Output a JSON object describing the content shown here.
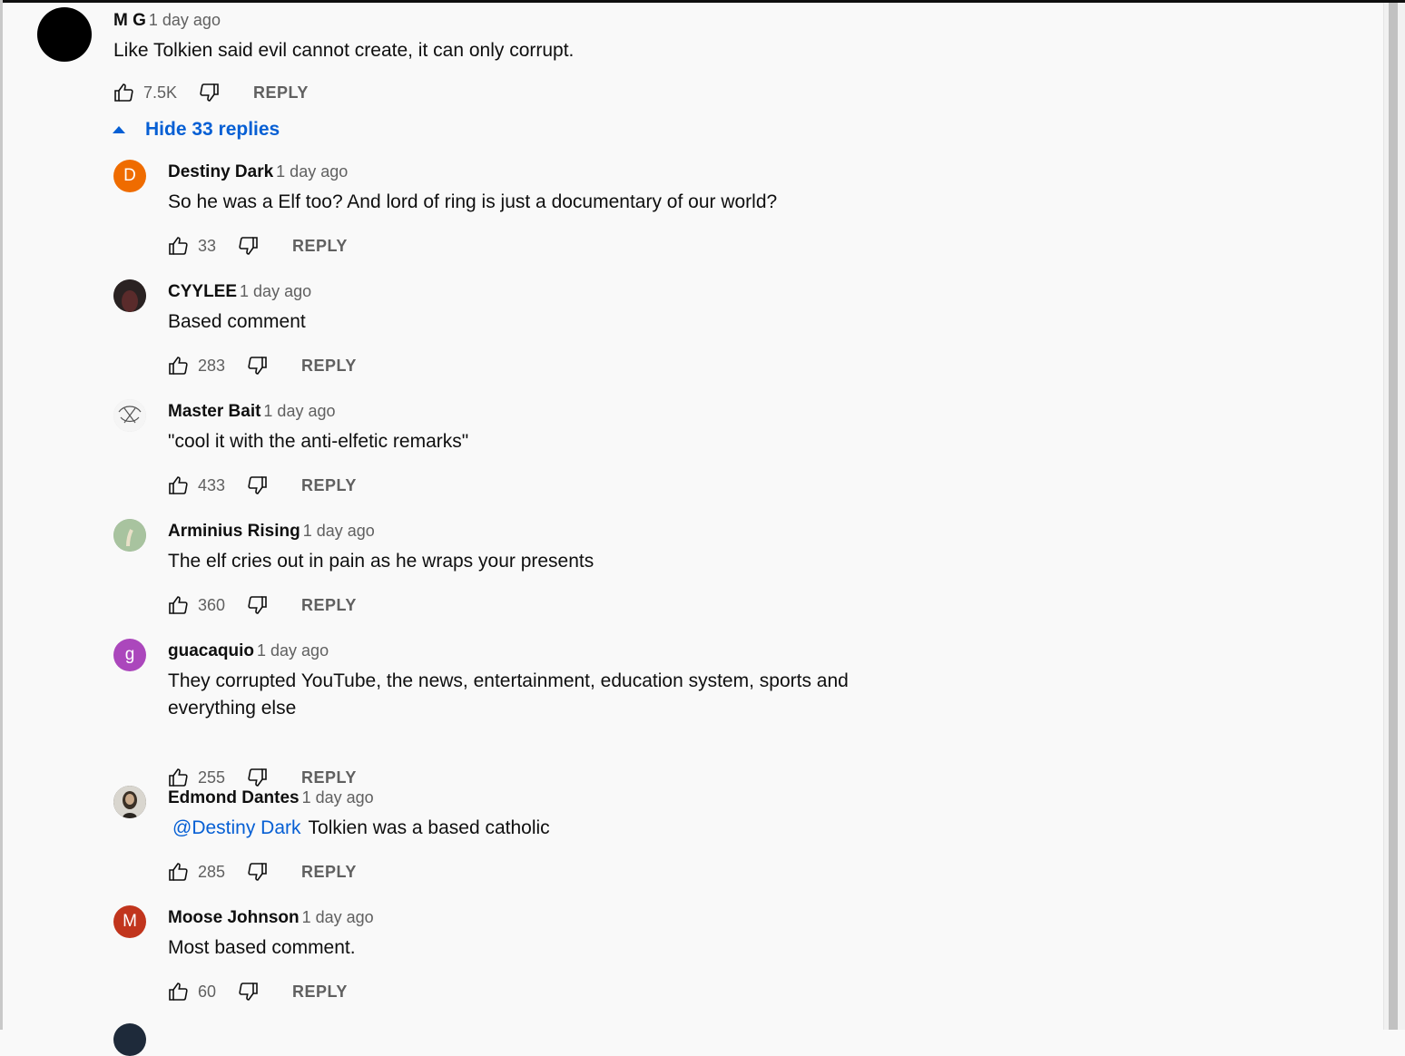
{
  "top_comment": {
    "author": "M G",
    "time": "1 day ago",
    "text": "Like Tolkien said evil cannot create, it can only corrupt.",
    "likes": "7.5K",
    "reply_label": "REPLY"
  },
  "replies_toggle": {
    "label": "Hide 33 replies"
  },
  "replies": [
    {
      "author": "Destiny Dark",
      "time": "1 day ago",
      "text": "So he was a Elf too? And lord of ring is just a documentary of our world?",
      "likes": "33",
      "reply_label": "REPLY",
      "avatar_letter": "D",
      "avatar_color": "#ef6c00"
    },
    {
      "author": "CYYLEE",
      "time": "1 day ago",
      "text": "Based comment",
      "likes": "283",
      "reply_label": "REPLY",
      "avatar_color": "#2b2b2b"
    },
    {
      "author": "Master Bait",
      "time": "1 day ago",
      "text": "\"cool it with the anti-elfetic remarks\"",
      "likes": "433",
      "reply_label": "REPLY",
      "avatar_color": "#e0e0e0"
    },
    {
      "author": "Arminius Rising",
      "time": "1 day ago",
      "text": "The elf cries out in pain as he wraps your presents",
      "likes": "360",
      "reply_label": "REPLY",
      "avatar_color": "#8fb08a"
    },
    {
      "author": "guacaquio",
      "time": "1 day ago",
      "text": "They corrupted YouTube, the news, entertainment, education system, sports and everything else",
      "likes": "255",
      "reply_label": "REPLY",
      "avatar_letter": "g",
      "avatar_color": "#ab47bc"
    },
    {
      "author": "Edmond Dantes",
      "time": "1 day ago",
      "mention": "@Destiny Dark",
      "text": "Tolkien was a based catholic",
      "likes": "285",
      "reply_label": "REPLY",
      "avatar_color": "#6d6a63"
    },
    {
      "author": "Moose Johnson",
      "time": "1 day ago",
      "text": "Most based comment.",
      "likes": "60",
      "reply_label": "REPLY",
      "avatar_letter": "M",
      "avatar_color": "#c1351d"
    }
  ]
}
